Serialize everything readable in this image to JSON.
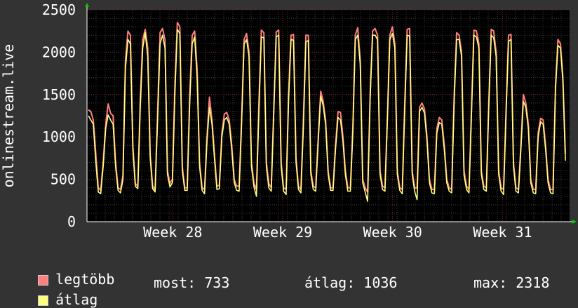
{
  "chart_data": {
    "type": "line",
    "ylabel": "onlinestream.live",
    "ylim": [
      0,
      2500
    ],
    "yticks": [
      0,
      500,
      1000,
      1500,
      2000,
      2500
    ],
    "x_tick_labels": [
      "Week 28",
      "Week 29",
      "Week 30",
      "Week 31"
    ],
    "grid": true,
    "series": [
      {
        "name": "legtöbb",
        "color": "#ff7f7f",
        "values": [
          1320,
          1300,
          1200,
          800,
          400,
          370,
          700,
          1150,
          1390,
          1280,
          1250,
          700,
          400,
          380,
          550,
          1900,
          2250,
          2200,
          900,
          450,
          420,
          1450,
          2150,
          2270,
          2050,
          800,
          420,
          380,
          1300,
          2230,
          2280,
          2150,
          600,
          450,
          500,
          1600,
          2350,
          2300,
          650,
          400,
          400,
          1500,
          2200,
          2250,
          1800,
          700,
          400,
          380,
          1000,
          1470,
          1200,
          800,
          420,
          430,
          1050,
          1270,
          1290,
          1200,
          900,
          500,
          420,
          420,
          1200,
          2150,
          2220,
          2000,
          700,
          450,
          380,
          1400,
          2260,
          2230,
          700,
          450,
          400,
          1300,
          2240,
          2260,
          700,
          400,
          380,
          1500,
          2200,
          2210,
          750,
          420,
          380,
          1200,
          2200,
          2200,
          600,
          420,
          400,
          1000,
          1540,
          1420,
          1200,
          600,
          400,
          400,
          900,
          1300,
          1290,
          1000,
          600,
          400,
          400,
          1100,
          2200,
          2290,
          1900,
          500,
          400,
          350,
          1500,
          2250,
          2280,
          2200,
          600,
          420,
          400,
          1250,
          2200,
          2300,
          2100,
          600,
          400,
          380,
          1400,
          2270,
          2280,
          600,
          400,
          400,
          1350,
          1400,
          1330,
          1000,
          500,
          380,
          380,
          1100,
          1230,
          1200,
          900,
          500,
          400,
          380,
          1500,
          2230,
          2200,
          2000,
          600,
          420,
          380,
          1300,
          2260,
          2250,
          2100,
          600,
          420,
          400,
          1400,
          2270,
          2250,
          2000,
          600,
          400,
          380,
          1300,
          2200,
          2210,
          700,
          400,
          380,
          900,
          1500,
          1400,
          1150,
          500,
          380,
          380,
          1050,
          1220,
          1200,
          900,
          500,
          380,
          380,
          1600,
          2150,
          2100,
          1700,
          800
        ]
      },
      {
        "name": "átlag",
        "color": "#ffff7f",
        "values": [
          1250,
          1200,
          1150,
          700,
          350,
          330,
          650,
          1100,
          1260,
          1200,
          1150,
          650,
          370,
          340,
          500,
          1800,
          2150,
          2100,
          850,
          420,
          390,
          1350,
          2050,
          2230,
          1950,
          750,
          390,
          350,
          1200,
          2100,
          2200,
          2050,
          560,
          410,
          460,
          1500,
          2270,
          2220,
          600,
          370,
          370,
          1400,
          2100,
          2180,
          1700,
          650,
          370,
          330,
          950,
          1350,
          1150,
          750,
          380,
          390,
          1000,
          1200,
          1230,
          1150,
          850,
          460,
          370,
          360,
          1150,
          2100,
          2150,
          1950,
          650,
          410,
          300,
          1300,
          2180,
          2170,
          650,
          400,
          360,
          1250,
          2180,
          2200,
          650,
          360,
          320,
          1420,
          2150,
          2140,
          700,
          380,
          340,
          1100,
          2120,
          2140,
          560,
          380,
          360,
          950,
          1480,
          1370,
          1150,
          560,
          370,
          370,
          850,
          1230,
          1200,
          950,
          550,
          360,
          360,
          1050,
          2150,
          2200,
          1850,
          460,
          350,
          240,
          1450,
          2200,
          2200,
          2150,
          560,
          380,
          360,
          1200,
          2150,
          2220,
          2050,
          560,
          370,
          330,
          1320,
          2200,
          2190,
          560,
          360,
          260,
          1300,
          1350,
          1280,
          950,
          460,
          340,
          330,
          1050,
          1170,
          1150,
          850,
          460,
          360,
          340,
          1420,
          2150,
          2150,
          1950,
          550,
          380,
          340,
          1250,
          2200,
          2180,
          2050,
          560,
          380,
          360,
          1350,
          2200,
          2170,
          1950,
          560,
          360,
          320,
          1250,
          2130,
          2150,
          650,
          360,
          340,
          850,
          1420,
          1350,
          1100,
          460,
          340,
          330,
          1000,
          1180,
          1150,
          850,
          460,
          340,
          330,
          1550,
          2080,
          2050,
          1650,
          720
        ]
      }
    ]
  },
  "legend": [
    {
      "label": "legtöbb",
      "color": "#ff7f7f"
    },
    {
      "label": "átlag",
      "color": "#ffff7f"
    }
  ],
  "stats": {
    "most": "most: 733",
    "atlag": "átlag: 1036",
    "max": "max: 2318"
  }
}
